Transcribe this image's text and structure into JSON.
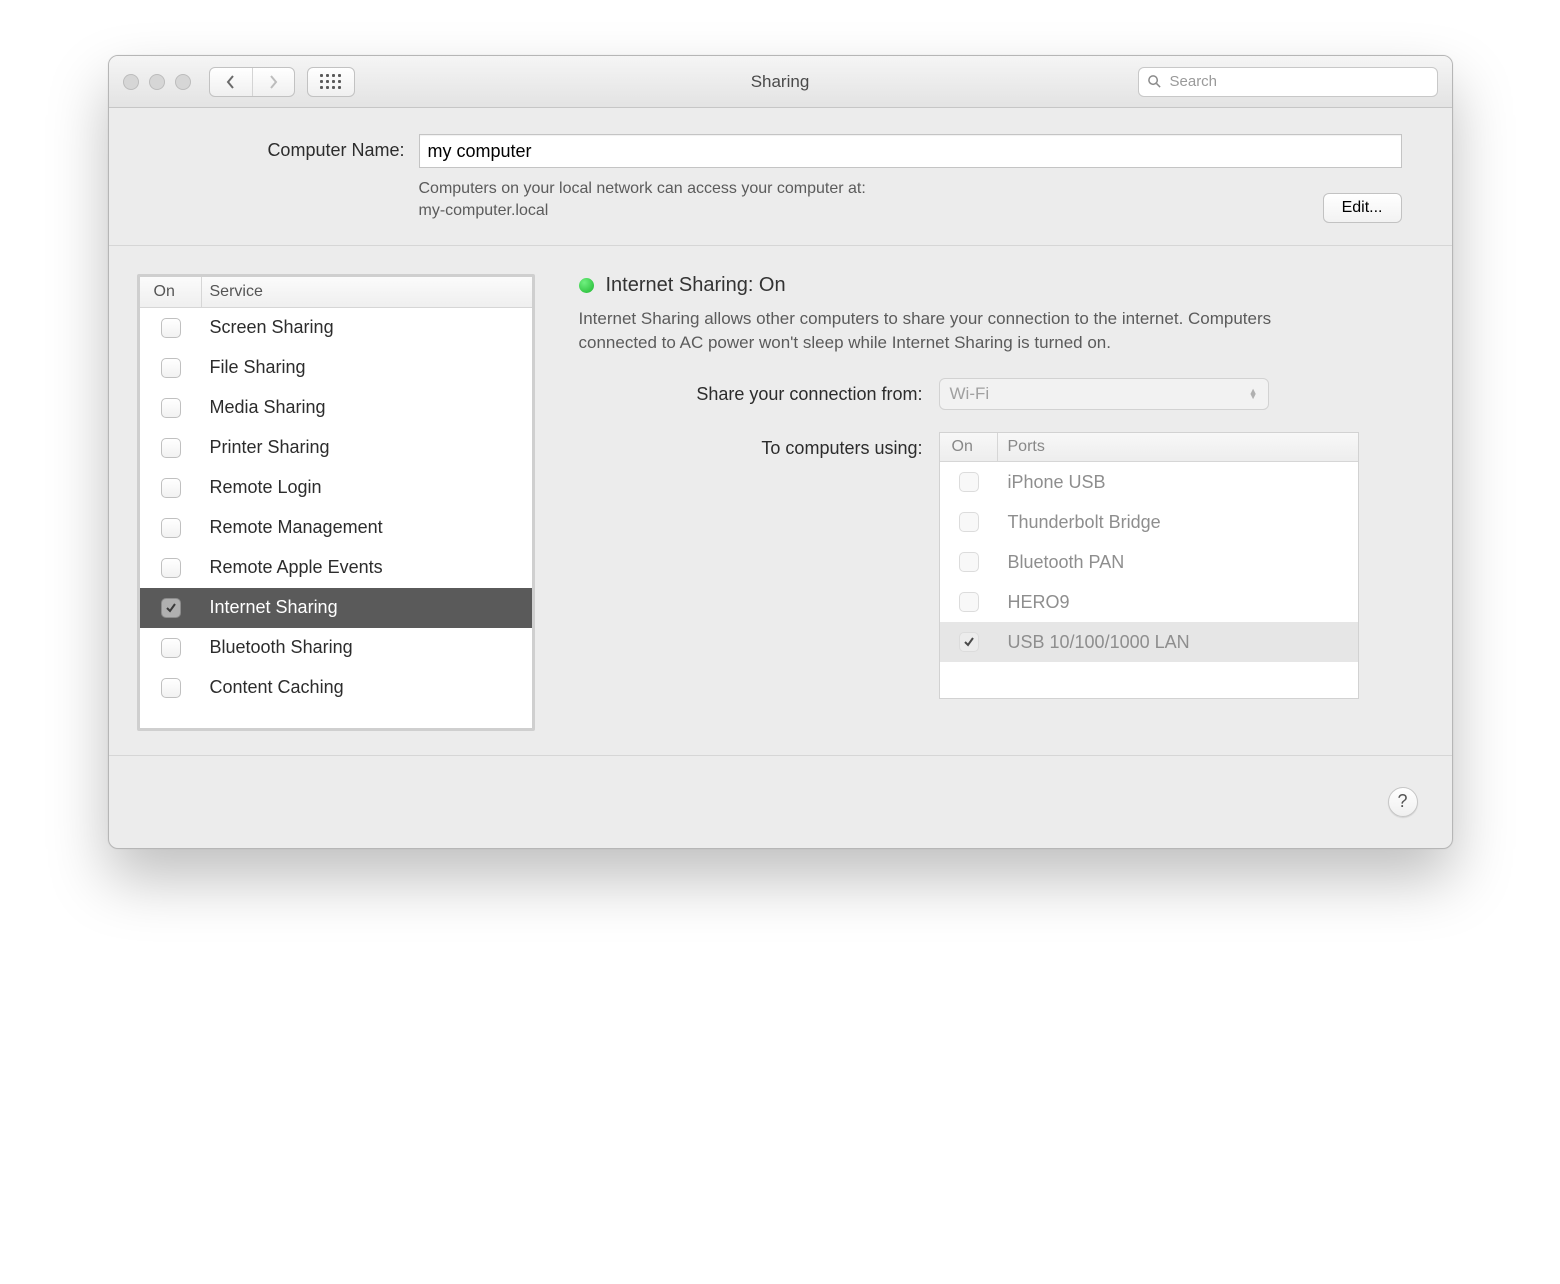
{
  "window": {
    "title": "Sharing",
    "search_placeholder": "Search"
  },
  "computer_name": {
    "label": "Computer Name:",
    "value": "my computer",
    "description_line1": "Computers on your local network can access your computer at:",
    "description_host": "my-computer.local",
    "edit_button": "Edit..."
  },
  "services": {
    "header_on": "On",
    "header_service": "Service",
    "items": [
      {
        "name": "Screen Sharing",
        "on": false,
        "selected": false
      },
      {
        "name": "File Sharing",
        "on": false,
        "selected": false
      },
      {
        "name": "Media Sharing",
        "on": false,
        "selected": false
      },
      {
        "name": "Printer Sharing",
        "on": false,
        "selected": false
      },
      {
        "name": "Remote Login",
        "on": false,
        "selected": false
      },
      {
        "name": "Remote Management",
        "on": false,
        "selected": false
      },
      {
        "name": "Remote Apple Events",
        "on": false,
        "selected": false
      },
      {
        "name": "Internet Sharing",
        "on": true,
        "selected": true
      },
      {
        "name": "Bluetooth Sharing",
        "on": false,
        "selected": false
      },
      {
        "name": "Content Caching",
        "on": false,
        "selected": false
      }
    ]
  },
  "detail": {
    "status_title": "Internet Sharing: On",
    "description": "Internet Sharing allows other computers to share your connection to the internet. Computers connected to AC power won't sleep while Internet Sharing is turned on.",
    "share_from_label": "Share your connection from:",
    "share_from_value": "Wi-Fi",
    "to_label": "To computers using:",
    "ports_header_on": "On",
    "ports_header_ports": "Ports",
    "ports": [
      {
        "name": "iPhone USB",
        "on": false,
        "selected": false
      },
      {
        "name": "Thunderbolt Bridge",
        "on": false,
        "selected": false
      },
      {
        "name": "Bluetooth PAN",
        "on": false,
        "selected": false
      },
      {
        "name": "HERO9",
        "on": false,
        "selected": false
      },
      {
        "name": "USB 10/100/1000 LAN",
        "on": true,
        "selected": true
      }
    ]
  },
  "help_label": "?"
}
